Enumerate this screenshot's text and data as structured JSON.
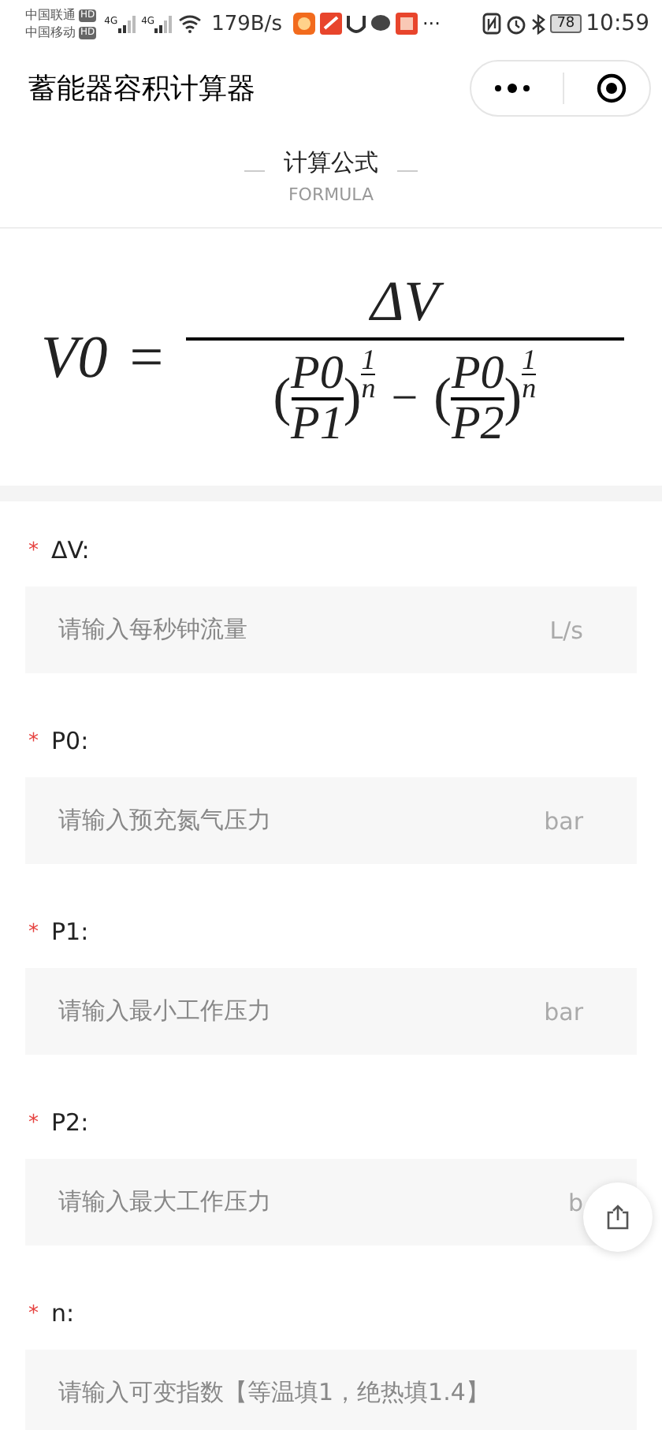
{
  "status_bar": {
    "carriers": [
      {
        "name": "中国联通",
        "badge": "HD"
      },
      {
        "name": "中国移动",
        "badge": "HD"
      }
    ],
    "network": [
      "4G",
      "4G"
    ],
    "speed": "179B/s",
    "more": "···",
    "battery": "78",
    "time": "10:59"
  },
  "header": {
    "title": "蓄能器容积计算器"
  },
  "section": {
    "title": "计算公式",
    "subtitle": "FORMULA"
  },
  "formula": {
    "lhs": "V0",
    "equals": "=",
    "numerator": "ΔV",
    "minus": "−",
    "terms": [
      {
        "open": "(",
        "num": "P0",
        "den": "P1",
        "close": ")",
        "exp_num": "1",
        "exp_den": "n"
      },
      {
        "open": "(",
        "num": "P0",
        "den": "P2",
        "close": ")",
        "exp_num": "1",
        "exp_den": "n"
      }
    ]
  },
  "fields": [
    {
      "required_mark": "*",
      "label": "ΔV:",
      "placeholder": "请输入每秒钟流量",
      "unit": "L/s"
    },
    {
      "required_mark": "*",
      "label": "P0:",
      "placeholder": "请输入预充氮气压力",
      "unit": "bar"
    },
    {
      "required_mark": "*",
      "label": "P1:",
      "placeholder": "请输入最小工作压力",
      "unit": "bar"
    },
    {
      "required_mark": "*",
      "label": "P2:",
      "placeholder": "请输入最大工作压力",
      "unit": "b"
    },
    {
      "required_mark": "*",
      "label": "n:",
      "placeholder": "请输入可变指数【等温填1，绝热填1.4】"
    }
  ]
}
